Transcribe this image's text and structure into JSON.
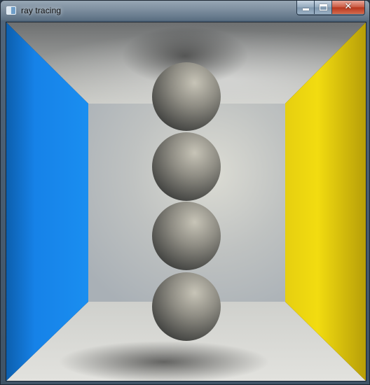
{
  "window": {
    "title": "ray tracing",
    "controls": {
      "minimize_icon": "minimize-icon",
      "maximize_icon": "maximize-icon",
      "close_icon": "close-icon"
    }
  },
  "scene": {
    "left_wall_color": "#1682e8",
    "right_wall_color": "#f2dc10",
    "back_wall_color": "#c4c6c4",
    "floor_color": "#d0d0cc",
    "ceiling_color": "#c9cac6",
    "sphere_color": "#8e8c82",
    "sphere_count": 4
  }
}
